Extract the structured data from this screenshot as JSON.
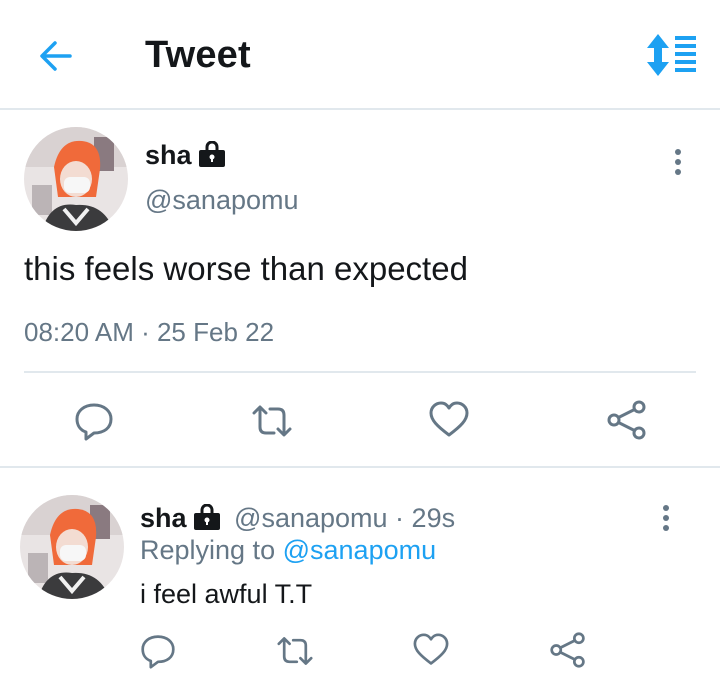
{
  "header": {
    "title": "Tweet"
  },
  "tweet": {
    "name": "sha",
    "handle": "@sanapomu",
    "text": "this feels worse than expected",
    "time": "08:20 AM",
    "separator": " · ",
    "date": "25 Feb 22"
  },
  "reply": {
    "name": "sha",
    "handle": "@sanapomu",
    "separator": " · ",
    "age": "29s",
    "replying_to_label": "Replying to",
    "replying_to_handle": "@sanapomu",
    "text": "i feel awful T.T"
  },
  "colors": {
    "accent": "#1da1f2",
    "secondary_text": "#657786",
    "icon": "#657786",
    "divider": "#e1e8ed"
  }
}
